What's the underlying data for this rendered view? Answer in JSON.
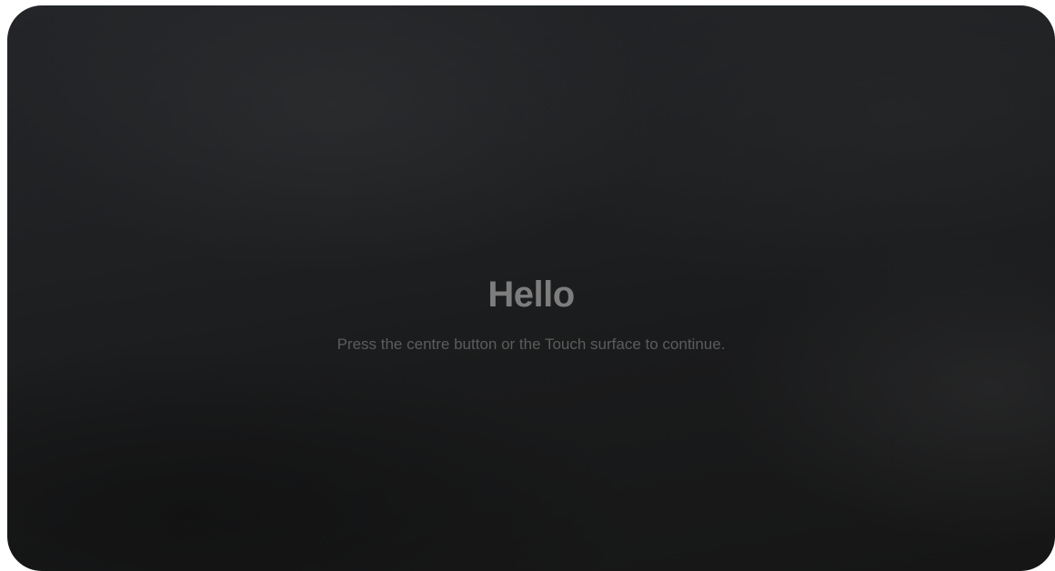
{
  "welcome": {
    "title": "Hello",
    "instruction": "Press the centre button or the Touch surface to continue."
  }
}
